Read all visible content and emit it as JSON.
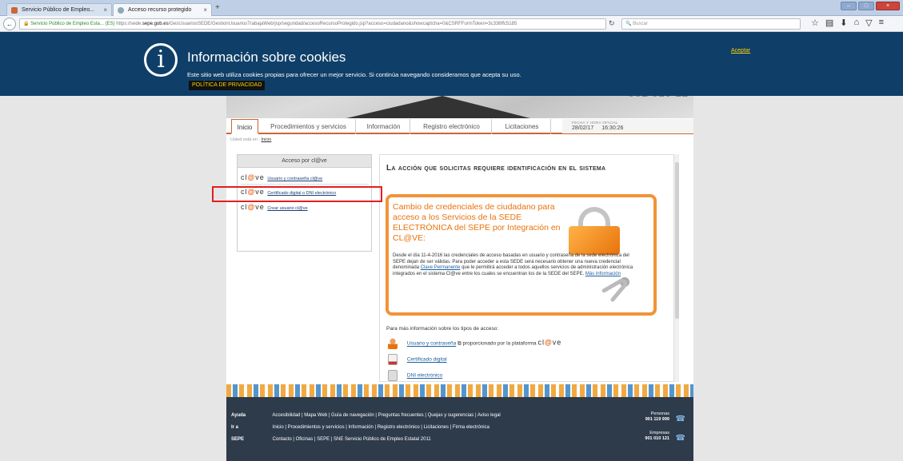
{
  "browser": {
    "tabs": [
      {
        "label": "Servicio Público de Empleo..."
      },
      {
        "label": "Acceso recurso protegido"
      }
    ],
    "identity": "Servicio Público de Empleo Esta... (ES)",
    "url_prefix": "https://sede.",
    "url_host": "sepe.gob.es",
    "url_rest": "/GesUsuariosSEDE/GestionUsuariosTrabajaWeb/jsp/seguridad/accesoRecursoProtegido.jsp?acceso=ciudadano&showcaptcha=0&CSRFFormToken=3c336ffc5185",
    "search_placeholder": "Buscar"
  },
  "cookie": {
    "title": "Información sobre cookies",
    "text": "Este sitio web utiliza cookies propias para ofrecer un mejor servicio. Si continúa navegando consideramos que acepta su uso.",
    "privacy_link": "POLÍTICA DE PRIVACIDAD",
    "accept": "Aceptar"
  },
  "hero": {
    "phone": "901 010 12"
  },
  "nav": {
    "tabs": [
      "Inicio",
      "Procedimientos y servicios",
      "Información",
      "Registro electrónico",
      "Licitaciones"
    ],
    "date_label": "FECHA Y HORA OFICIAL",
    "date": "28/02/17",
    "time": "16:30:26"
  },
  "breadcrumb": {
    "prefix": "Usted está en :",
    "link": "Inicio"
  },
  "access": {
    "title": "Acceso por cl@ve",
    "logo_a": "cl",
    "logo_at": "@",
    "logo_b": "ve",
    "options": [
      "Usuario y contraseña cl@ve",
      "Certificado digital o DNI electrónico",
      "Crear usuario cl@ve"
    ]
  },
  "main": {
    "heading": "La acción que solicitas requiere identificación en el sistema",
    "box_title": "Cambio de credenciales de ciudadano para acceso a los Servicios de la SEDE ELECTRÓNICA del SEPE por Integración en CL@VE:",
    "box_text_1": "Desde el día 11-4-2016 las credenciales de acceso basadas en usuario y contraseña de la sede electrónica del SEPE dejan de ser válidas. Para poder acceder a esta SEDE será necesario obtener una nueva credencial denominada",
    "box_link_1": "Clave Permanente",
    "box_text_2": "que le permitirá acceder a todos aquellos servicios de administración electrónica integrados en el sistema Cl@ve entre los cuales se encuentran los de la SEDE del SEPE.",
    "box_link_2": "Más información",
    "more_info": "Para más información sobre los tipos de acceso:",
    "link_1": "Usuario y contraseña",
    "link_1_suffix": "proporcionado por la plataforma",
    "link_2": "Certificado digital",
    "link_3": "DNI electrónico"
  },
  "footer": {
    "rows": [
      {
        "label": "Ayuda",
        "items": "Accesibilidad | Mapa Web | Guía de navegación | Preguntas frecuentes | Quejas y sugerencias | Aviso legal"
      },
      {
        "label": "Ir a",
        "items": "Inicio | Procedimientos y servicios | Información | Registro electrónico | Licitaciones | Firma electrónica"
      },
      {
        "label": "SEPE",
        "items": "Contacto | Oficinas | SEPE | SNE Servicio Público de Empleo Estatal 2011"
      }
    ],
    "phone1_label": "Personas",
    "phone1": "901 119 999",
    "phone2_label": "Empresas",
    "phone2": "901 010 121"
  },
  "colors": {
    "banner": "#0f3f68",
    "accent": "#e8720c",
    "highlight": "#e02020"
  }
}
